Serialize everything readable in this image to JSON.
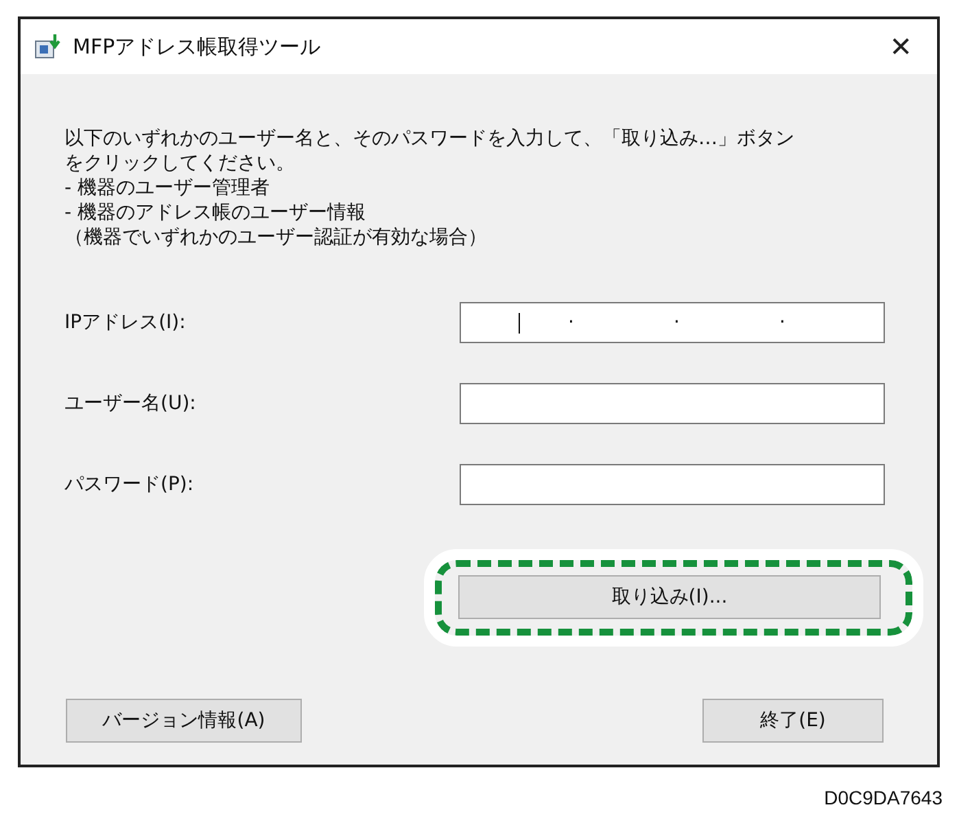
{
  "window": {
    "title": "MFPアドレス帳取得ツール",
    "close": "✕"
  },
  "instructions": [
    "以下のいずれかのユーザー名と、そのパスワードを入力して、「取り込み…」ボタン",
    "をクリックしてください。",
    "- 機器のユーザー管理者",
    "- 機器のアドレス帳のユーザー情報",
    "（機器でいずれかのユーザー認証が有効な場合）"
  ],
  "fields": [
    {
      "kind": "ip",
      "label": "IPアドレス(I):",
      "separators": [
        ".",
        ".",
        "."
      ]
    },
    {
      "kind": "text",
      "label": "ユーザー名(U):"
    },
    {
      "kind": "text",
      "label": "パスワード(P):"
    }
  ],
  "import_button": {
    "label": "取り込み(I)...",
    "highlighted": true
  },
  "buttons": [
    {
      "label": "バージョン情報(A)"
    },
    {
      "label": "終了(E)"
    }
  ],
  "figure_code": "D0C9DA7643"
}
